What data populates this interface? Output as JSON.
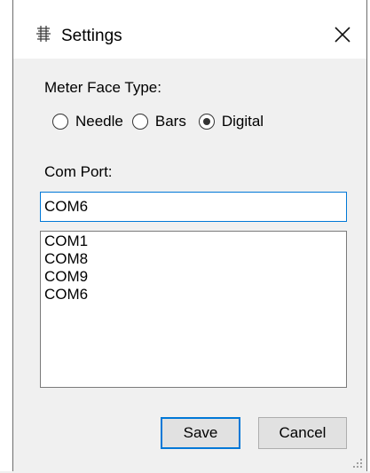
{
  "window": {
    "title": "Settings",
    "icon": "settings-app-icon",
    "close_icon": "close-icon"
  },
  "meter_face": {
    "label": "Meter Face Type:",
    "options": [
      {
        "label": "Needle",
        "selected": false
      },
      {
        "label": "Bars",
        "selected": false
      },
      {
        "label": "Digital",
        "selected": true
      }
    ]
  },
  "com_port": {
    "label": "Com Port:",
    "value": "COM6",
    "list": [
      "COM1",
      "COM8",
      "COM9",
      "COM6"
    ]
  },
  "buttons": {
    "save": "Save",
    "cancel": "Cancel"
  },
  "colors": {
    "accent": "#0078d7",
    "dialog_bg": "#f0f0f0",
    "titlebar_bg": "#ffffff"
  }
}
